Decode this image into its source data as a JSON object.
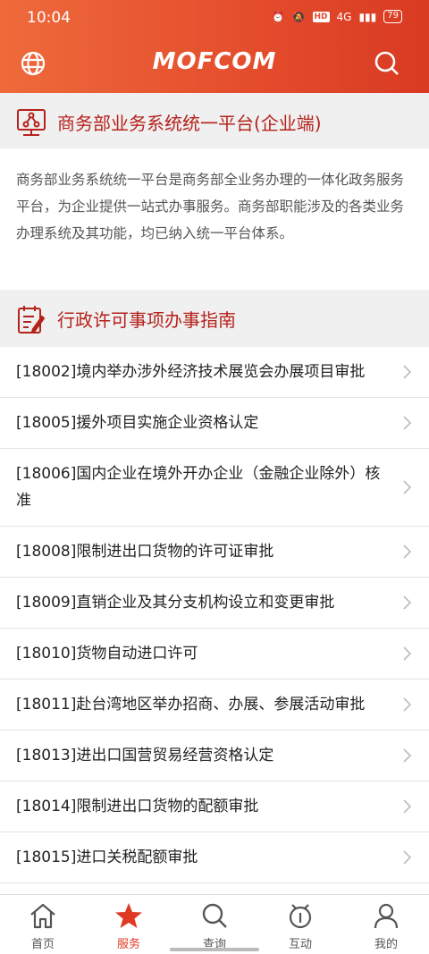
{
  "status_bar": {
    "time": "10:04",
    "network": "4G",
    "hd": "HD",
    "battery": "79"
  },
  "header": {
    "logo": "MOFCOM"
  },
  "platform": {
    "title": "商务部业务系统统一平台(企业端)",
    "description": "商务部业务系统统一平台是商务部全业务办理的一体化政务服务平台，为企业提供一站式办事服务。商务部职能涉及的各类业务办理系统及其功能，均已纳入统一平台体系。"
  },
  "guide": {
    "title": "行政许可事项办事指南",
    "items": [
      "[18002]境内举办涉外经济技术展览会办展项目审批",
      "[18005]援外项目实施企业资格认定",
      "[18006]国内企业在境外开办企业（金融企业除外）核准",
      "[18008]限制进出口货物的许可证审批",
      "[18009]直销企业及其分支机构设立和变更审批",
      "[18010]货物自动进口许可",
      "[18011]赴台湾地区举办招商、办展、参展活动审批",
      "[18013]进出口国营贸易经营资格认定",
      "[18014]限制进出口货物的配额审批",
      "[18015]进口关税配额审批"
    ]
  },
  "nav": [
    {
      "label": "首页",
      "icon": "home-icon"
    },
    {
      "label": "服务",
      "icon": "star-icon",
      "active": true
    },
    {
      "label": "查询",
      "icon": "search-icon"
    },
    {
      "label": "互动",
      "icon": "interact-icon"
    },
    {
      "label": "我的",
      "icon": "user-icon"
    }
  ],
  "colors": {
    "accent": "#e44c2c",
    "section_title": "#b5221c",
    "active_nav": "#e03a25"
  }
}
